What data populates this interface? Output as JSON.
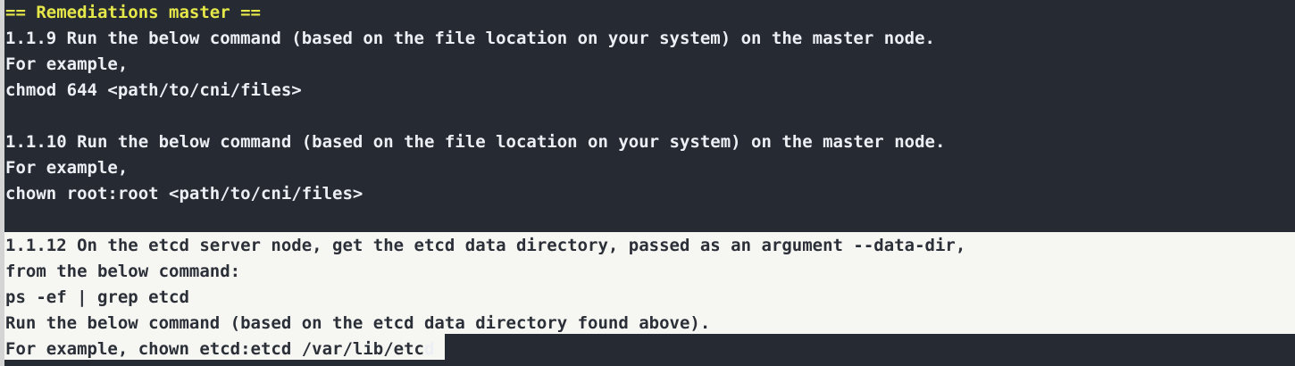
{
  "terminal": {
    "heading": "== Remediations master ==",
    "lines": [
      "1.1.9 Run the below command (based on the file location on your system) on the master node.",
      "For example,",
      "chmod 644 <path/to/cni/files>",
      "",
      "1.1.10 Run the below command (based on the file location on your system) on the master node.",
      "For example,",
      "chown root:root <path/to/cni/files>",
      "",
      "1.1.12 On the etcd server node, get the etcd data directory, passed as an argument --data-dir,",
      "from the below command:",
      "ps -ef | grep etcd",
      "Run the below command (based on the etcd data directory found above).",
      "For example, chown etcd:etcd /var/lib/etc"
    ],
    "last_line_tail": "d"
  },
  "colors": {
    "background": "#262a33",
    "text": "#eceff4",
    "heading": "#e6e84a",
    "selection": "#f6f6f2",
    "selection_text": "#2b2f38"
  }
}
